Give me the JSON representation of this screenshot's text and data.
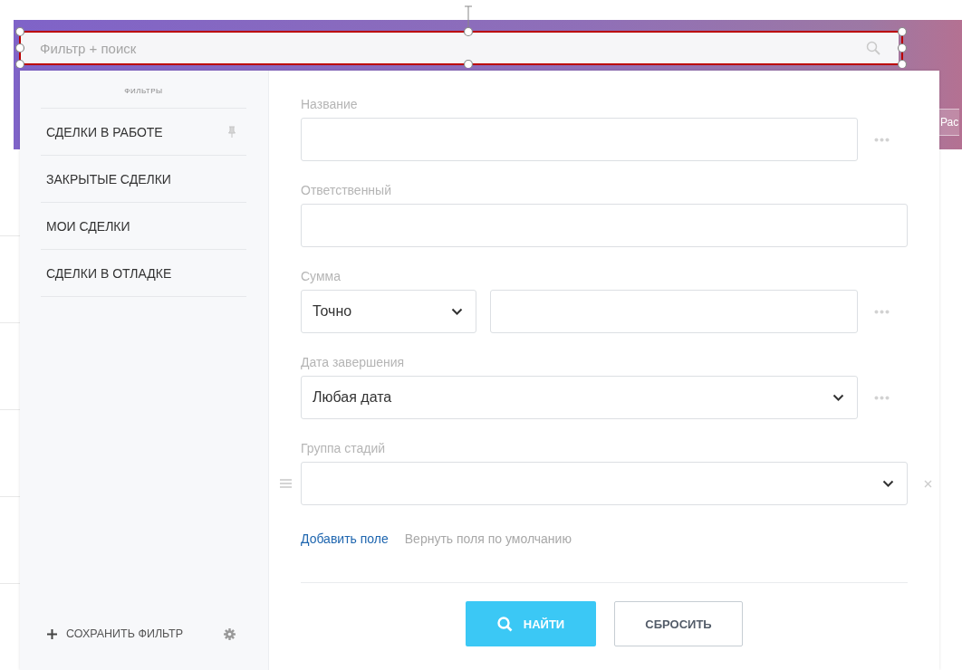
{
  "background": {
    "header_tab": "Рас"
  },
  "search": {
    "placeholder": "Фильтр + поиск"
  },
  "sidebar": {
    "title": "ФИЛЬТРЫ",
    "items": [
      {
        "label": "СДЕЛКИ В РАБОТЕ",
        "pinned": true
      },
      {
        "label": "ЗАКРЫТЫЕ СДЕЛКИ",
        "pinned": false
      },
      {
        "label": "МОИ СДЕЛКИ",
        "pinned": false
      },
      {
        "label": "СДЕЛКИ В ОТЛАДКЕ",
        "pinned": false
      }
    ],
    "save_label": "СОХРАНИТЬ ФИЛЬТР"
  },
  "fields": [
    {
      "kind": "text",
      "label": "Название",
      "has_more": true,
      "removable": false
    },
    {
      "kind": "text",
      "label": "Ответственный",
      "has_more": false,
      "removable": false
    },
    {
      "kind": "compound",
      "label": "Сумма",
      "option": "Точно",
      "has_more": true,
      "removable": false
    },
    {
      "kind": "select",
      "label": "Дата завершения",
      "value": "Любая дата",
      "has_more": true,
      "removable": false
    },
    {
      "kind": "select",
      "label": "Группа стадий",
      "has_more": false,
      "removable": true
    }
  ],
  "links": {
    "add": "Добавить поле",
    "restore": "Вернуть поля по умолчанию"
  },
  "buttons": {
    "find": "НАЙТИ",
    "reset": "СБРОСИТЬ"
  }
}
